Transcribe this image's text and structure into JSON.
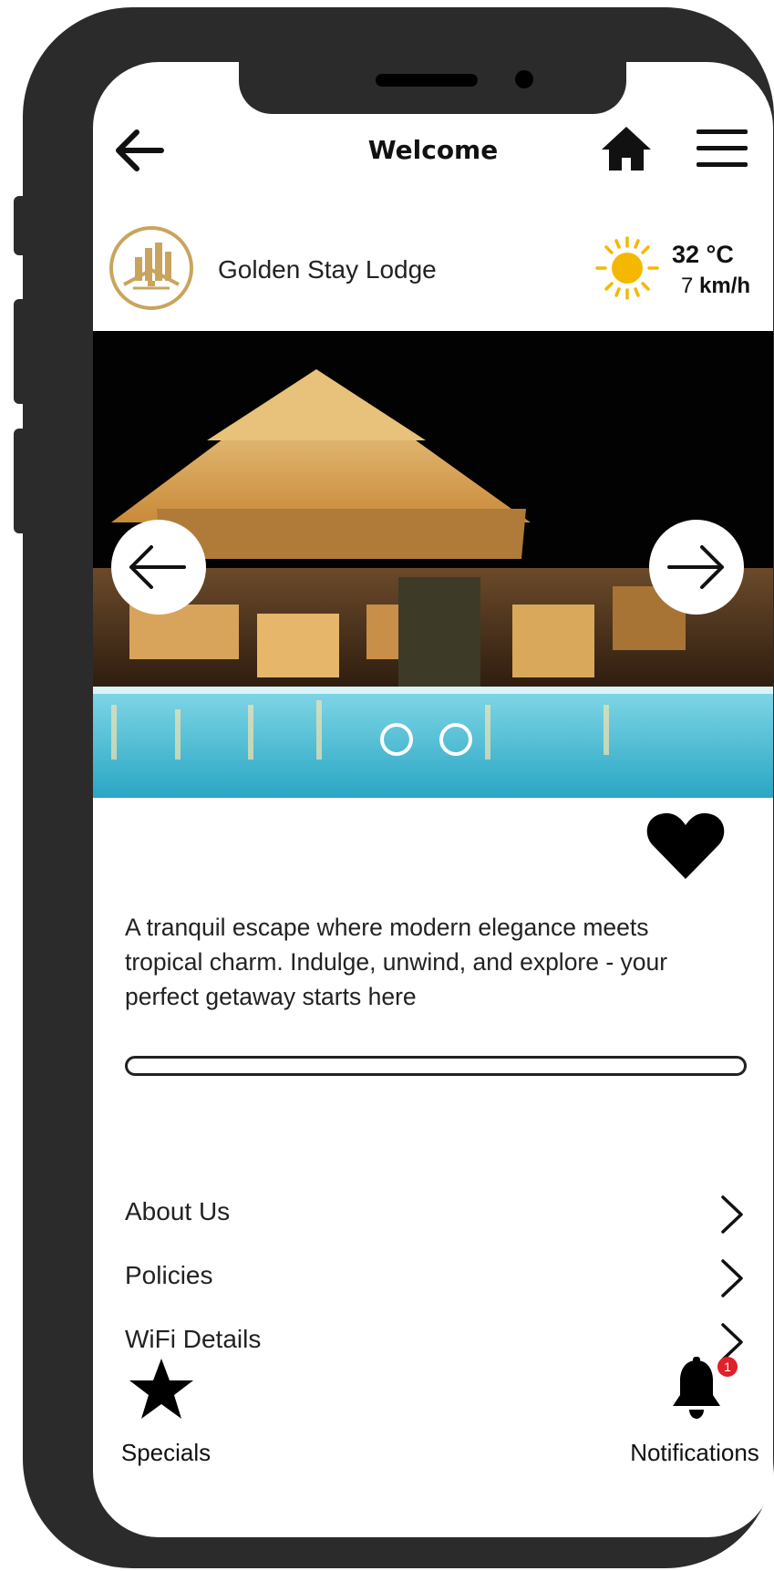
{
  "header": {
    "title": "Welcome",
    "back_icon": "arrow-left-icon",
    "home_icon": "home-icon",
    "menu_icon": "hamburger-menu-icon"
  },
  "hotel": {
    "name": "Golden Stay Lodge",
    "logo_icon": "building-logo-icon"
  },
  "weather": {
    "icon": "sun-icon",
    "temperature": "32 °C",
    "wind_value": "7",
    "wind_unit": "km/h"
  },
  "carousel": {
    "prev_icon": "arrow-left-icon",
    "next_icon": "arrow-right-icon",
    "slide_count": 2
  },
  "favorite": {
    "icon": "heart-icon"
  },
  "description": "A tranquil escape where modern elegance meets tropical charm. Indulge, unwind, and explore - your perfect getaway starts here",
  "progress": {
    "value": 0
  },
  "menu": {
    "items": [
      {
        "label": "About Us"
      },
      {
        "label": "Policies"
      },
      {
        "label": "WiFi Details"
      }
    ]
  },
  "bottom_nav": {
    "specials_label": "Specials",
    "specials_icon": "star-icon",
    "notifications_label": "Notifications",
    "notifications_icon": "bell-icon",
    "notification_count": "1"
  },
  "colors": {
    "frame": "#2b2b2b",
    "logo_gold": "#c9a45d",
    "sun": "#f5b800",
    "badge": "#e0202a"
  }
}
